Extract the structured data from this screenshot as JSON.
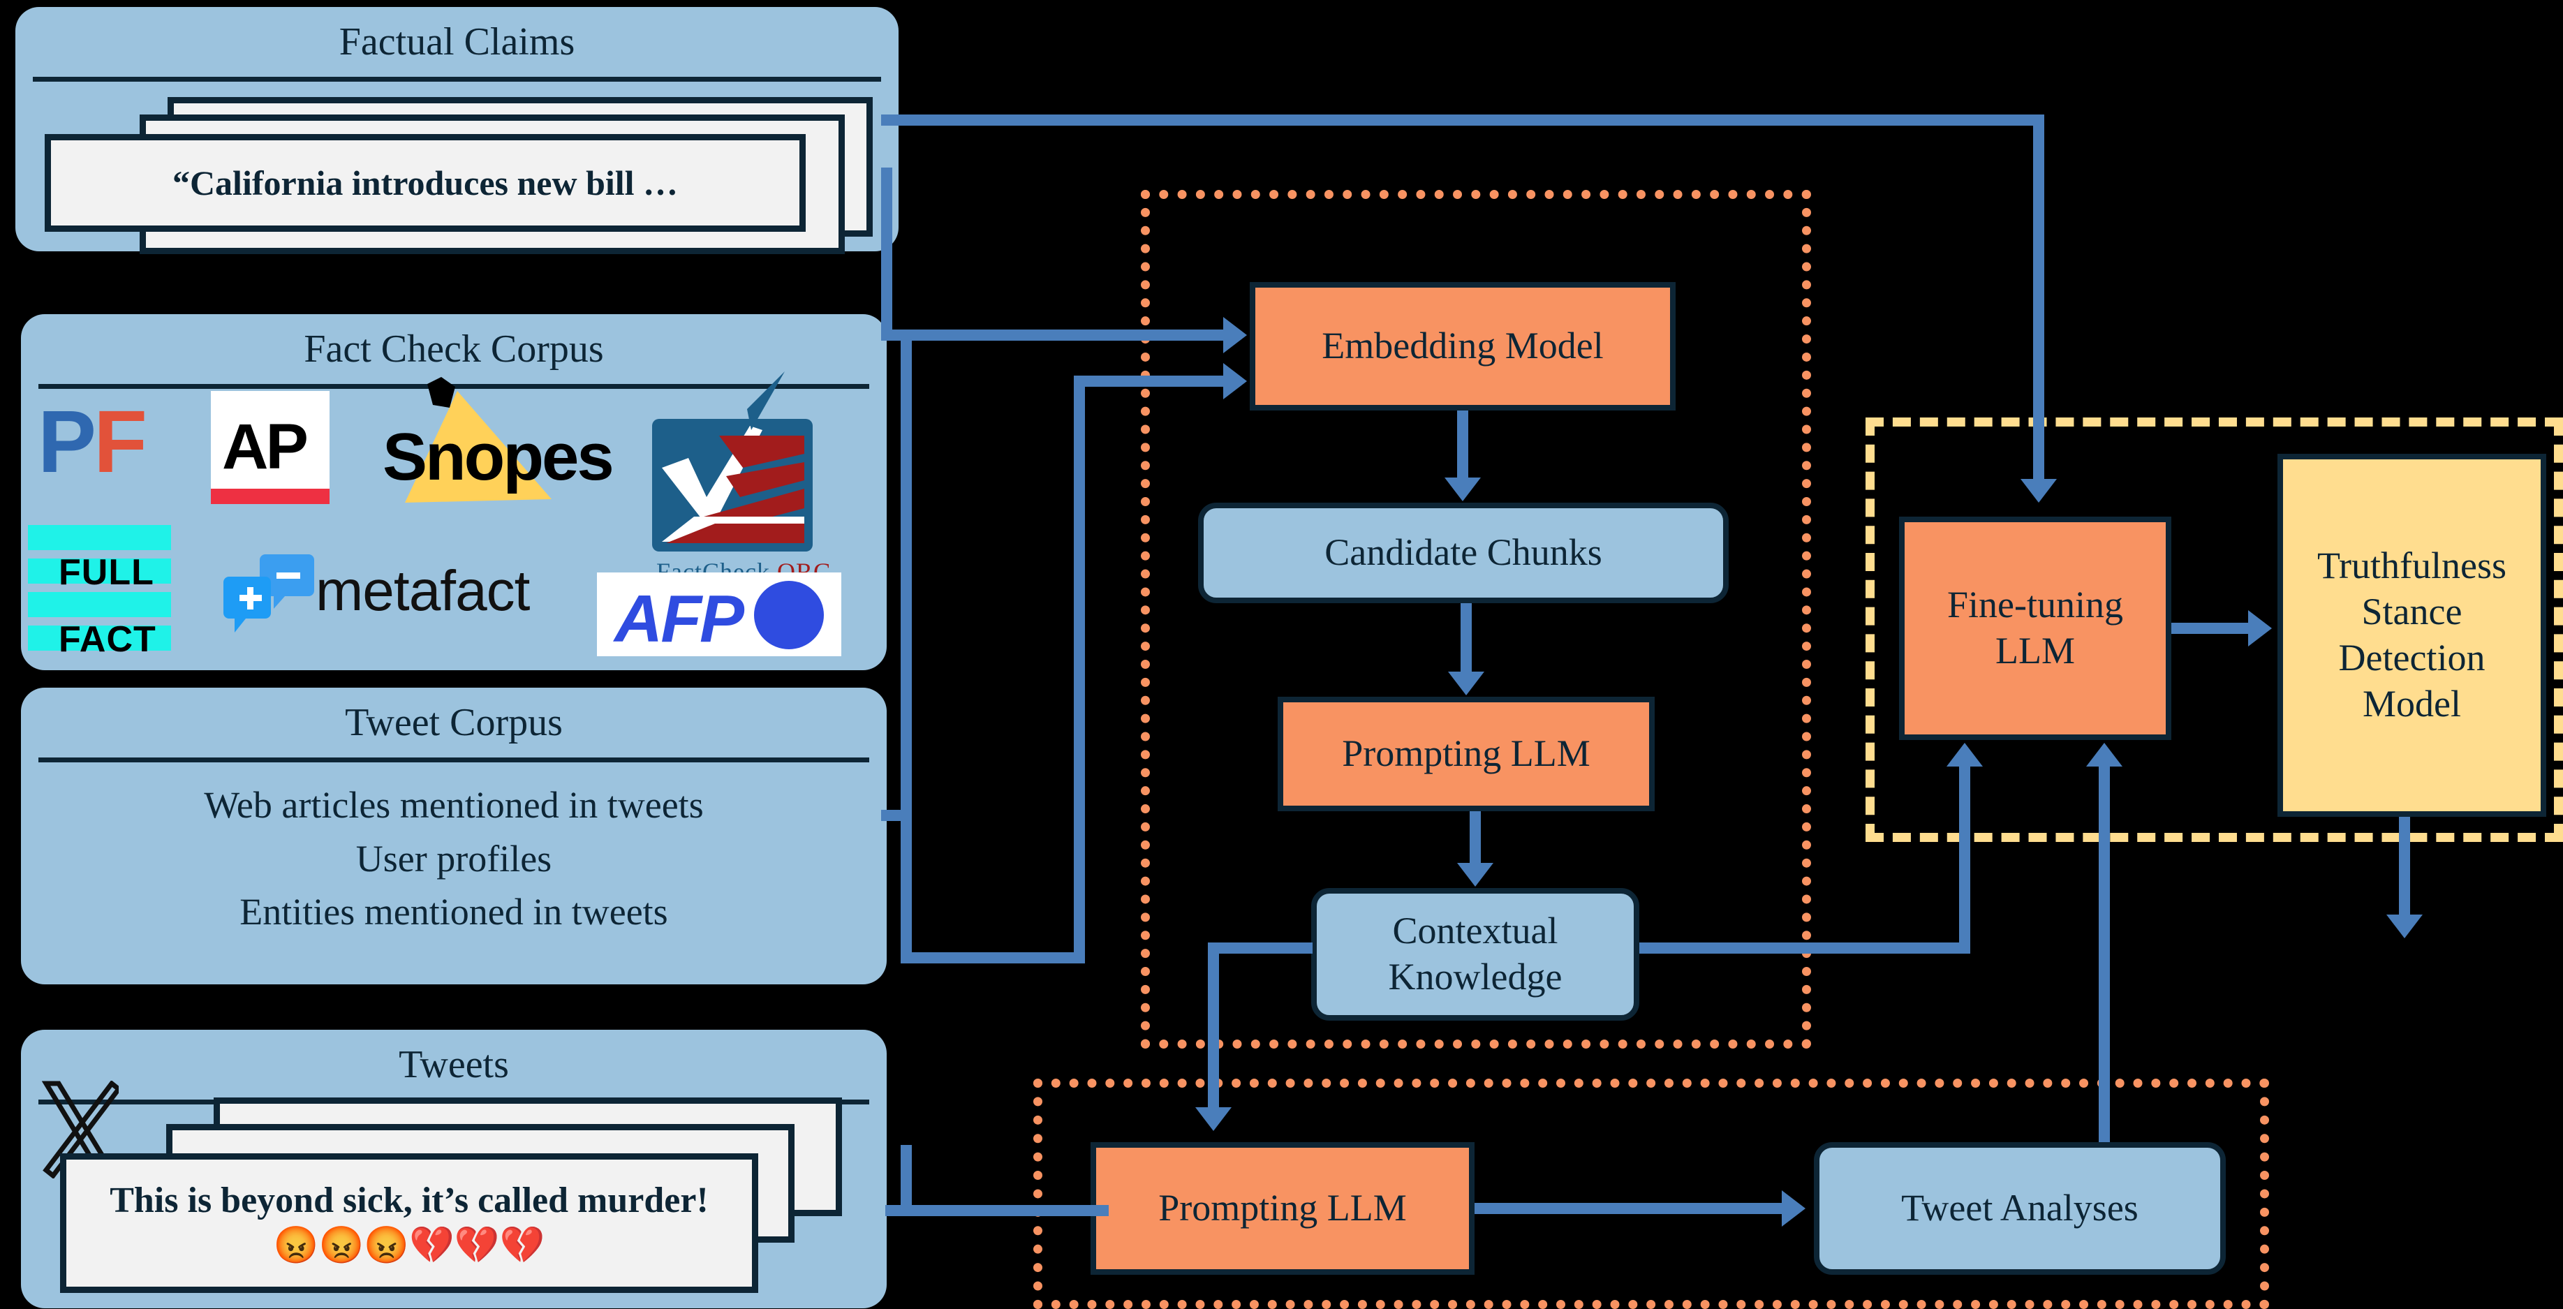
{
  "colors": {
    "background": "#000000",
    "panel_blue": "#9cc3de",
    "node_orange": "#f89362",
    "node_yellow": "#ffdd8f",
    "arrow_blue": "#4a7ebb",
    "outline_dark": "#0d2535",
    "card_white": "#f2f2f2"
  },
  "panels": {
    "factual_claims": {
      "title": "Factual Claims",
      "card_text": "“California introduces new bill …"
    },
    "fact_check_corpus": {
      "title": "Fact Check Corpus",
      "logos": [
        {
          "name": "politifact-logo",
          "text_p": "P",
          "text_f": "F"
        },
        {
          "name": "ap-logo",
          "label": "AP"
        },
        {
          "name": "snopes-logo",
          "label": "Snopes"
        },
        {
          "name": "factcheck-org-logo",
          "label": "FactCheck",
          "suffix": ".ORG"
        },
        {
          "name": "full-fact-logo",
          "line1": "FULL",
          "line2": "FACT"
        },
        {
          "name": "metafact-logo",
          "label": "metafact"
        },
        {
          "name": "afp-logo",
          "label": "AFP"
        }
      ]
    },
    "tweet_corpus": {
      "title": "Tweet Corpus",
      "lines": [
        "Web articles mentioned in tweets",
        "User profiles",
        "Entities mentioned in tweets"
      ]
    },
    "tweets": {
      "title": "Tweets",
      "platform_icon": "x-logo",
      "card_text": "This is beyond sick, it’s called murder! 😡😡😡💔💔💔"
    }
  },
  "nodes": {
    "embedding_model": "Embedding Model",
    "candidate_chunks": "Candidate Chunks",
    "prompting_llm_rag": "Prompting LLM",
    "contextual_knowledge": "Contextual Knowledge",
    "prompting_llm_tweets": "Prompting LLM",
    "tweet_analyses": "Tweet Analyses",
    "fine_tuning_llm": "Fine-tuning LLM",
    "truthfulness_model": "Truthfulness Stance Detection Model"
  },
  "groups": {
    "rag_pipeline": {
      "style": "orange-dotted"
    },
    "tweet_pipeline": {
      "style": "orange-dotted"
    },
    "finetune_group": {
      "style": "yellow-dashdot"
    }
  }
}
